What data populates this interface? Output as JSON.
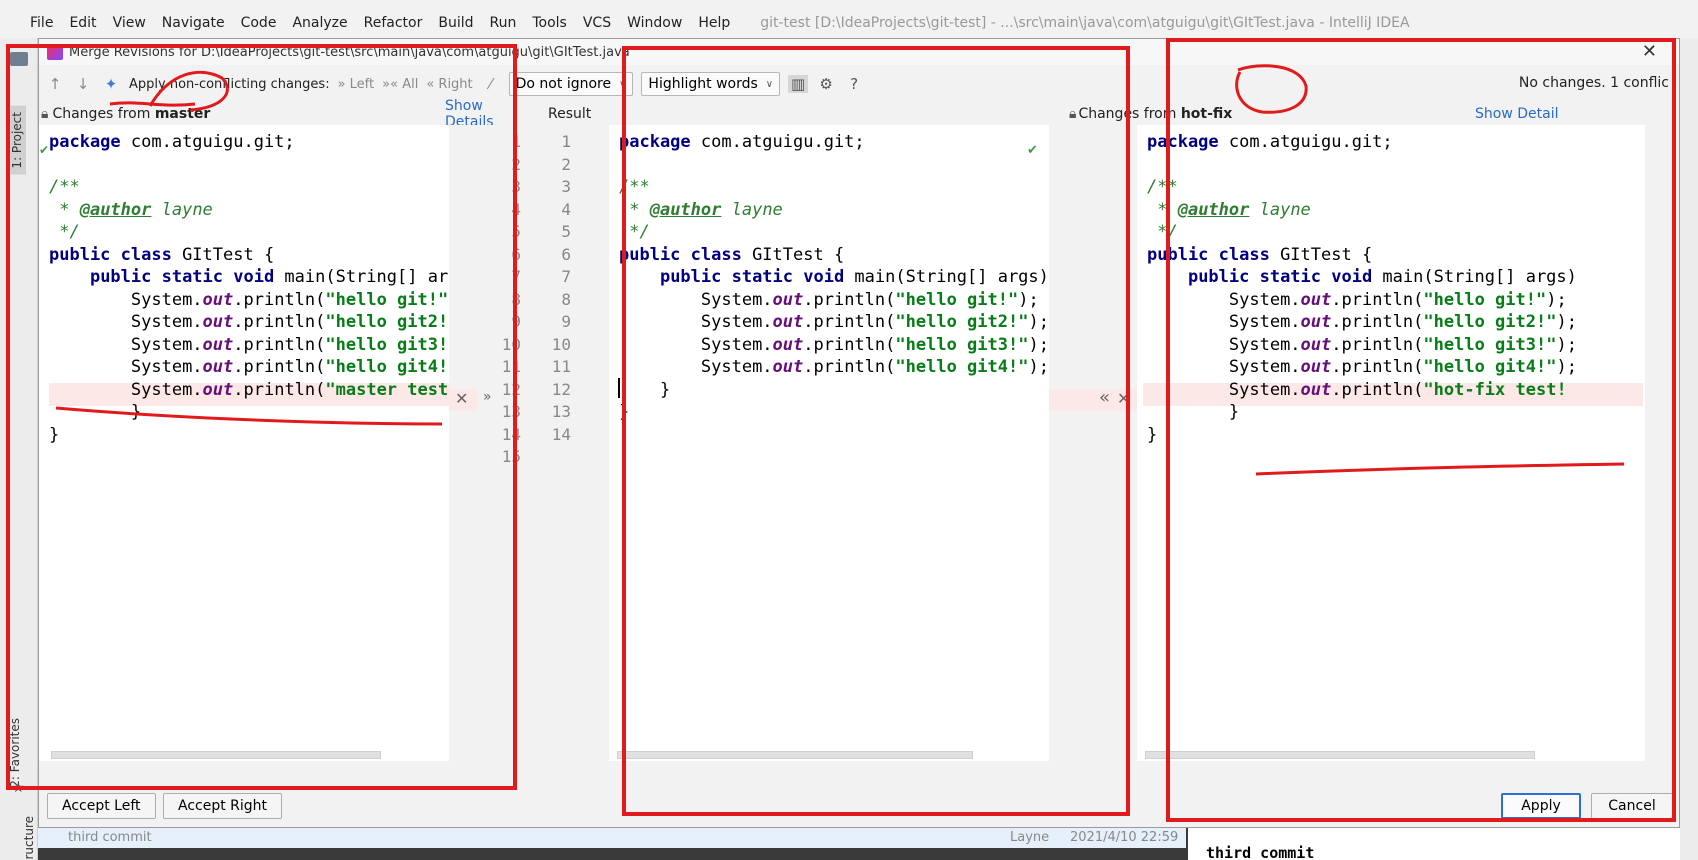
{
  "menubar": {
    "items": [
      "File",
      "Edit",
      "View",
      "Navigate",
      "Code",
      "Analyze",
      "Refactor",
      "Build",
      "Run",
      "Tools",
      "VCS",
      "Window",
      "Help"
    ],
    "window_title": "git-test [D:\\IdeaProjects\\git-test] - ...\\src\\main\\java\\com\\atguigu\\git\\GItTest.java - IntelliJ IDEA"
  },
  "side_tabs": {
    "project": "1: Project",
    "favorites": "2: Favorites",
    "structure": "Z: Structure"
  },
  "dialog": {
    "title": "Merge Revisions for D:\\IdeaProjects\\git-test\\src\\main\\java\\com\\atguigu\\git\\GItTest.java",
    "close_icon": "close-icon",
    "toolbar": {
      "apply_label": "Apply non-conflicting changes:",
      "left": "Left",
      "all": "All",
      "right": "Right",
      "ignore_option": "Do not ignore",
      "highlight_option": "Highlight words",
      "help": "?"
    },
    "status": "No changes. 1 conflic",
    "left_header": {
      "prefix": "Changes from",
      "branch": "master",
      "link": "Show Details"
    },
    "result_header": "Result",
    "right_header": {
      "prefix": "Changes from",
      "branch": "hot-fix",
      "link": "Show Detail"
    },
    "line_numbers": [
      "1",
      "2",
      "3",
      "4",
      "5",
      "6",
      "7",
      "8",
      "9",
      "10",
      "11",
      "12",
      "13",
      "14",
      "15"
    ],
    "buttons": {
      "accept_left": "Accept Left",
      "accept_right": "Accept Right",
      "apply": "Apply",
      "cancel": "Cancel"
    }
  },
  "code": {
    "package_kw": "package",
    "package_name": " com.atguigu.git;",
    "doc_open": "/**",
    "doc_author_prefix": " * ",
    "doc_author_tag": "@author",
    "doc_author_name": " layne",
    "doc_close": " */",
    "class_kw": "public class",
    "class_name": " GItTest {",
    "main_kw": "public static void",
    "main_sig": " main(String[] args)",
    "sysout_prefix": "System.",
    "sysout_field": "out",
    "sysout_method": ".println(",
    "strings": [
      "\"hello git!\"",
      "\"hello git2!\"",
      "\"hello git3!\"",
      "\"hello git4!\""
    ],
    "left_conflict": "\"master test!",
    "right_conflict": "\"hot-fix test!",
    "line_end": ");",
    "close_brace_inner": "    }",
    "close_brace_outer": "}"
  },
  "log": {
    "commit_msg": "third commit",
    "author": "Layne",
    "date": "2021/4/10 22:59",
    "detail_title": "third commit"
  }
}
